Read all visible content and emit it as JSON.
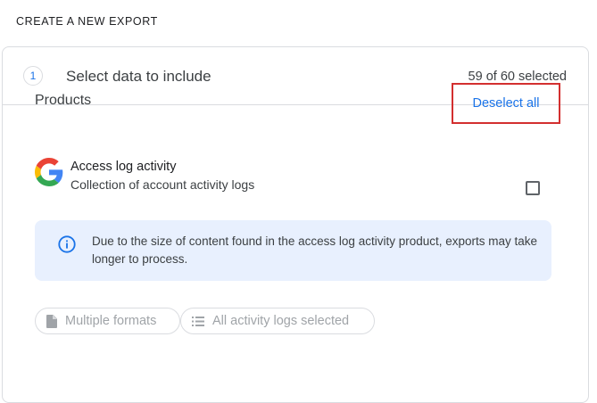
{
  "header": {
    "title": "CREATE A NEW EXPORT"
  },
  "step": {
    "number": "1",
    "title": "Select data to include",
    "selected_count": "59 of 60 selected"
  },
  "products": {
    "label": "Products",
    "deselect_all_label": "Deselect all",
    "items": [
      {
        "icon": "google-g-logo",
        "title": "Access log activity",
        "description": "Collection of account activity logs",
        "checked": false,
        "info_message": "Due to the size of content found in the access log activity product, exports may take longer to process.",
        "chips": [
          {
            "icon": "file-icon",
            "label": "Multiple formats"
          },
          {
            "icon": "list-icon",
            "label": "All activity logs selected"
          }
        ]
      }
    ]
  },
  "colors": {
    "accent": "#1a73e8",
    "info_bg": "#e8f0fe",
    "highlight_border": "#d32f2f"
  }
}
